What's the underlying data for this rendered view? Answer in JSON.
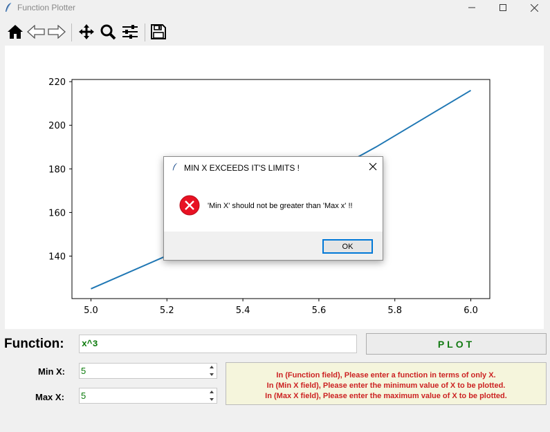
{
  "window": {
    "title": "Function Plotter"
  },
  "toolbar": {
    "buttons": [
      "home-icon",
      "back-icon",
      "forward-icon",
      "pan-icon",
      "zoom-icon",
      "configure-icon",
      "save-icon"
    ]
  },
  "chart_data": {
    "type": "line",
    "x": [
      5.0,
      5.25,
      5.5,
      5.75,
      6.0
    ],
    "y": [
      125,
      144,
      166,
      190,
      216
    ],
    "function": "x^3",
    "xlim": [
      4.95,
      6.05
    ],
    "ylim": [
      120.5,
      221
    ],
    "x_ticks": [
      "5.0",
      "5.2",
      "5.4",
      "5.6",
      "5.8",
      "6.0"
    ],
    "x_tick_values": [
      5.0,
      5.2,
      5.4,
      5.6,
      5.8,
      6.0
    ],
    "y_ticks": [
      "140",
      "160",
      "180",
      "200",
      "220"
    ],
    "y_tick_values": [
      140,
      160,
      180,
      200,
      220
    ],
    "line_color": "#1f77b4",
    "grid": false
  },
  "form": {
    "function_label": "Function:",
    "function_value": "x^3",
    "plot_button": "PLOT",
    "min_label": "Min X:",
    "min_value": "5",
    "max_label": "Max X:",
    "max_value": "5"
  },
  "info": {
    "line1": "In (Function field), Please enter a function in terms of only X.",
    "line2": "In (Min X field), Please enter the minimum value of X to be plotted.",
    "line3": "In (Max X field), Please enter the maximum value of X to be plotted."
  },
  "dialog": {
    "title": "MIN X EXCEEDS IT'S LIMITS !",
    "message": "'Min X' should not be greater than 'Max x' !!",
    "ok": "OK"
  },
  "colors": {
    "accent": "#0078d7",
    "error": "#e81123",
    "input_text": "#0a7a0a",
    "info_text": "#cc2222",
    "info_bg": "#f5f5dc"
  }
}
